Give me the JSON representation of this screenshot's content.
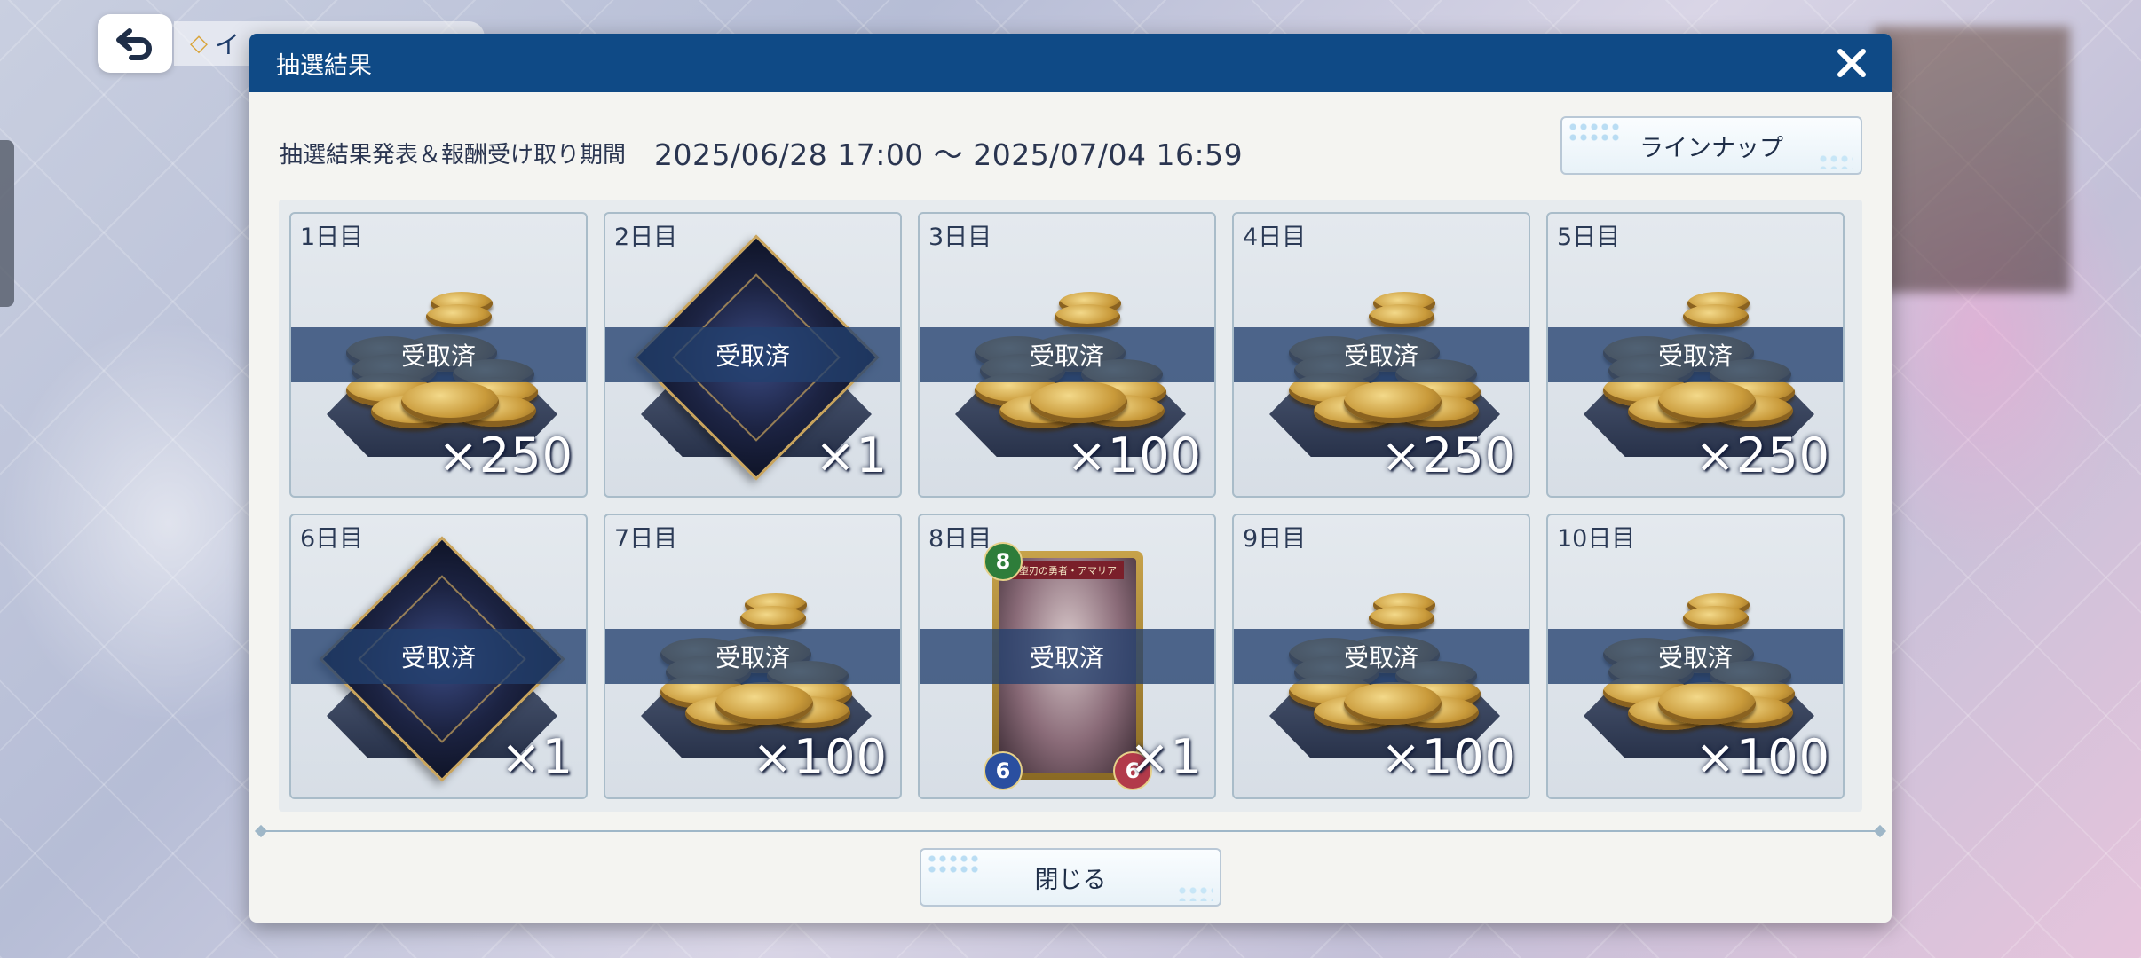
{
  "top_bar": {
    "back_icon": "back-arrow-icon",
    "label": "イ"
  },
  "dialog": {
    "title": "抽選結果",
    "close_icon": "close-x-icon",
    "period_label": "抽選結果発表＆報酬受け取り期間",
    "period_value": "2025/06/28 17:00 ～ 2025/07/04 16:59",
    "lineup_button": "ラインナップ",
    "close_button": "閉じる",
    "rewards": [
      {
        "day": "1日目",
        "item": "coins",
        "status": "受取済",
        "quantity": "×250"
      },
      {
        "day": "2日目",
        "item": "emblem",
        "status": "受取済",
        "quantity": "×1"
      },
      {
        "day": "3日目",
        "item": "coins",
        "status": "受取済",
        "quantity": "×100"
      },
      {
        "day": "4日目",
        "item": "coins",
        "status": "受取済",
        "quantity": "×250"
      },
      {
        "day": "5日目",
        "item": "coins",
        "status": "受取済",
        "quantity": "×250"
      },
      {
        "day": "6日目",
        "item": "emblem",
        "status": "受取済",
        "quantity": "×1"
      },
      {
        "day": "7日目",
        "item": "coins",
        "status": "受取済",
        "quantity": "×100"
      },
      {
        "day": "8日目",
        "item": "card",
        "status": "受取済",
        "quantity": "×1",
        "card": {
          "name": "堕刃の勇者・アマリア",
          "cost": "8",
          "attack": "6",
          "life": "6"
        }
      },
      {
        "day": "9日目",
        "item": "coins",
        "status": "受取済",
        "quantity": "×100"
      },
      {
        "day": "10日目",
        "item": "coins",
        "status": "受取済",
        "quantity": "×100"
      }
    ]
  },
  "colors": {
    "header": "#0f4a86",
    "status_band": "#23406e",
    "panel": "#f4f4f1"
  }
}
